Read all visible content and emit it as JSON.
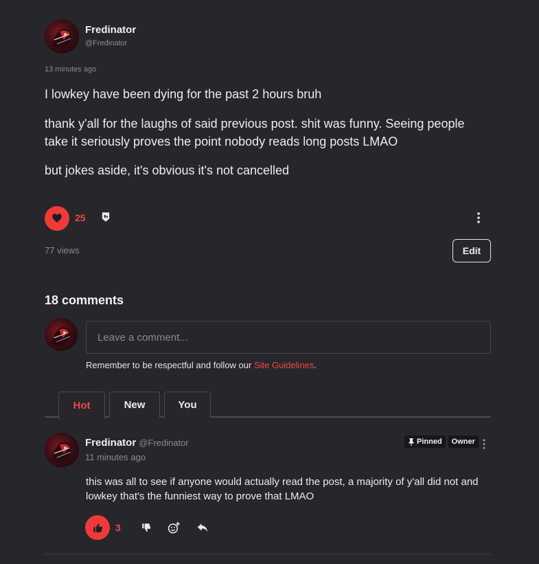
{
  "post": {
    "author": {
      "name": "Fredinator",
      "handle": "@Fredinator"
    },
    "timestamp": "13 minutes ago",
    "paragraphs": [
      "I lowkey have been dying for the past 2 hours bruh",
      "thank y'all for the laughs of said previous post. shit was funny. Seeing people take it seriously proves the point nobody reads long posts LMAO",
      "but jokes aside, it's obvious it's not cancelled"
    ],
    "like_count": "25",
    "views": "77 views",
    "edit_label": "Edit"
  },
  "comments": {
    "heading": "18 comments",
    "input_placeholder": "Leave a comment...",
    "guidelines_prefix": "Remember to be respectful and follow our ",
    "guidelines_link": "Site Guidelines",
    "guidelines_suffix": ".",
    "tabs": [
      {
        "label": "Hot",
        "active": true
      },
      {
        "label": "New",
        "active": false
      },
      {
        "label": "You",
        "active": false
      }
    ],
    "items": [
      {
        "author": "Fredinator",
        "handle": "@Fredinator",
        "timestamp": "11 minutes ago",
        "badges": {
          "pinned": "Pinned",
          "owner": "Owner"
        },
        "text": "this was all to see if anyone would actually read the post, a majority of y'all did not and lowkey that's the funniest way to prove that LMAO",
        "like_count": "3"
      }
    ]
  },
  "colors": {
    "background": "#26262b",
    "accent_red": "#f03a3a",
    "muted_text": "#8a8a90"
  },
  "icons": [
    "heart-icon",
    "award-icon",
    "more-vertical-icon",
    "thumbs-up-icon",
    "thumbs-down-icon",
    "add-reaction-icon",
    "reply-icon",
    "pin-icon"
  ]
}
